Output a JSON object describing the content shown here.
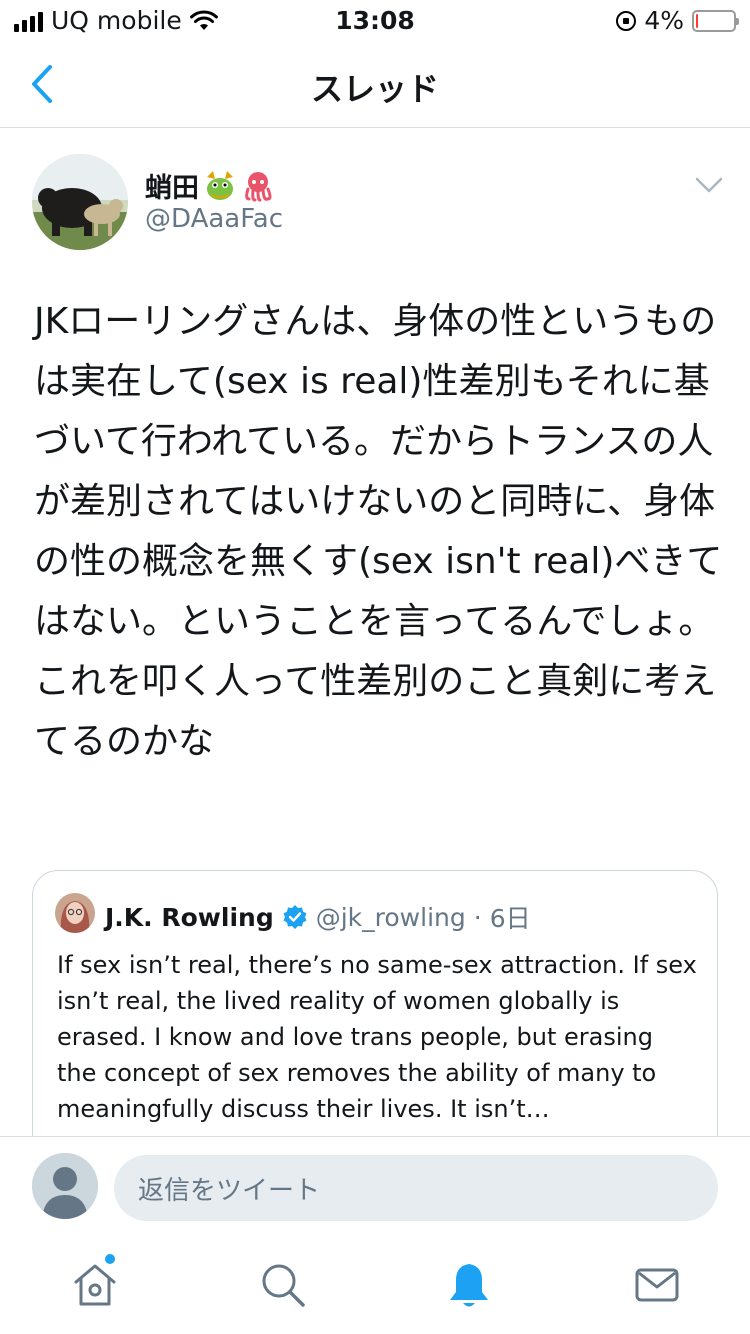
{
  "status_bar": {
    "carrier": "UQ mobile",
    "time": "13:08",
    "battery_percent": "4%",
    "battery_level": 0.04
  },
  "header": {
    "title": "スレッド",
    "back_icon": "chevron-left-icon"
  },
  "tweet": {
    "display_name": "蛸田",
    "emojis": [
      "dragon-face-icon",
      "octopus-icon"
    ],
    "handle": "@DAaaFac",
    "text": "JKローリングさんは、身体の性というものは実在して(sex is real)性差別もそれに基づいて行われている。だからトランスの人が差別されてはいけないのと同時に、身体の性の概念を無くす(sex isn't real)べきてはない。ということを言ってるんでしょ。\nこれを叩く人って性差別のこと真剣に考えてるのかな"
  },
  "quoted_tweet": {
    "name": "J.K. Rowling",
    "verified": true,
    "handle": "@jk_rowling",
    "separator": "·",
    "time": "6日",
    "text": "If sex isn’t real, there’s no same-sex attraction. If sex isn’t real, the lived reality of women globally is erased. I know and love trans people, but erasing the concept of sex removes the ability of many to meaningfully discuss their lives. It isn’t…"
  },
  "reply": {
    "placeholder": "返信をツイート"
  },
  "tabs": [
    "home-icon",
    "search-icon",
    "notifications-icon",
    "messages-icon"
  ],
  "colors": {
    "accent": "#1da1f2",
    "secondary_text": "#657786",
    "border": "#ccd6dd",
    "battery_low": "#ff3b30"
  }
}
